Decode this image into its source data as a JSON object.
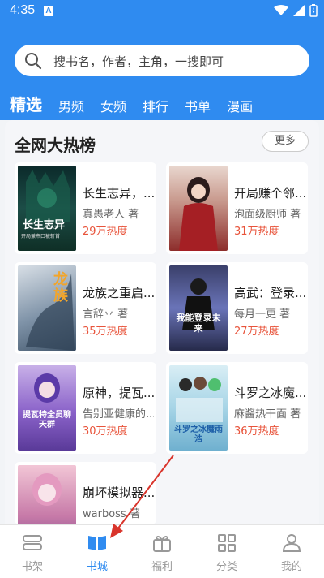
{
  "status": {
    "time": "4:35",
    "indicator": "A"
  },
  "search": {
    "placeholder": "搜书名，作者，主角，一搜即可"
  },
  "tabs": [
    {
      "label": "精选"
    },
    {
      "label": "男频"
    },
    {
      "label": "女频"
    },
    {
      "label": "排行"
    },
    {
      "label": "书单"
    },
    {
      "label": "漫画"
    }
  ],
  "section": {
    "title": "全网大热榜",
    "more": "更多"
  },
  "books": [
    {
      "title": "长生志异，...",
      "author": "真愚老人 著",
      "heat": "29万热度"
    },
    {
      "title": "开局赚个邻...",
      "author": "泡面级厨师 著",
      "heat": "31万热度"
    },
    {
      "title": "龙族之重启...",
      "author": "言辞丷 著",
      "heat": "35万热度"
    },
    {
      "title": "高武：登录...",
      "author": "每月一更 著",
      "heat": "27万热度"
    },
    {
      "title": "原神，提瓦...",
      "author": "告别亚健康的...",
      "heat": "30万热度"
    },
    {
      "title": "斗罗之冰魔...",
      "author": "麻酱热干面 著",
      "heat": "36万热度"
    },
    {
      "title": "崩坏模拟器...",
      "author": "warboss 著",
      "heat": ""
    }
  ],
  "covers": [
    {
      "text": "长生志异",
      "sub": "开局兼市口被斩首"
    },
    {
      "text": "",
      "sub": ""
    },
    {
      "text": "龙族",
      "sub": ""
    },
    {
      "text": "我能登录未来",
      "sub": ""
    },
    {
      "text": "提瓦特全员聊天群",
      "sub": ""
    },
    {
      "text": "斗罗之冰魔雨浩",
      "sub": ""
    },
    {
      "text": "",
      "sub": ""
    }
  ],
  "nav": [
    {
      "label": "书架",
      "icon": "bookshelf-icon"
    },
    {
      "label": "书城",
      "icon": "open-book-icon"
    },
    {
      "label": "福利",
      "icon": "gift-icon"
    },
    {
      "label": "分类",
      "icon": "grid-icon"
    },
    {
      "label": "我的",
      "icon": "user-icon"
    }
  ],
  "colors": {
    "accent": "#2f8bf0",
    "heat": "#e8533a",
    "annotation": "#d9342b"
  }
}
